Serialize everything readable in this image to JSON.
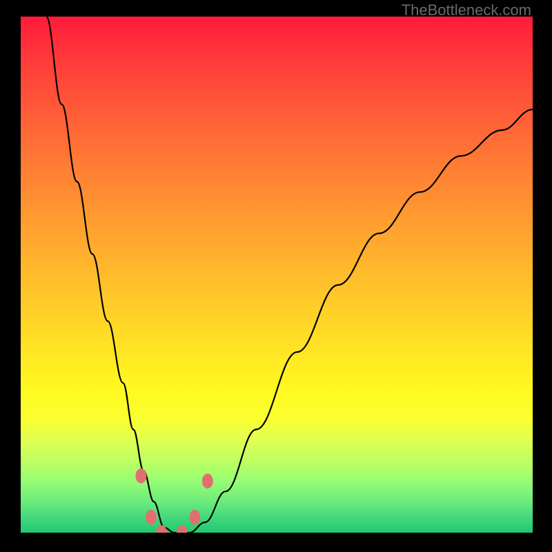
{
  "watermark": "TheBottleneck.com",
  "chart_data": {
    "type": "line",
    "title": "",
    "xlabel": "",
    "ylabel": "",
    "xlim": [
      0,
      100
    ],
    "ylim": [
      0,
      100
    ],
    "grid": false,
    "legend": false,
    "background_gradient": {
      "direction": "vertical",
      "stops": [
        {
          "pos": 0,
          "color": "#ff1a3a"
        },
        {
          "pos": 50,
          "color": "#ffc028"
        },
        {
          "pos": 78,
          "color": "#faff30"
        },
        {
          "pos": 100,
          "color": "#22c770"
        }
      ]
    },
    "series": [
      {
        "name": "bottleneck-curve",
        "color": "#000000",
        "x": [
          5,
          8,
          11,
          14,
          17,
          20,
          22,
          24,
          26,
          28,
          30,
          33,
          36,
          40,
          46,
          54,
          62,
          70,
          78,
          86,
          94,
          100
        ],
        "y": [
          100,
          83,
          68,
          54,
          41,
          29,
          20,
          12,
          6,
          1,
          0,
          0,
          2,
          8,
          20,
          35,
          48,
          58,
          66,
          73,
          78,
          82
        ]
      }
    ],
    "markers": [
      {
        "x": 23.5,
        "y": 11,
        "color": "#e07070",
        "r": 8
      },
      {
        "x": 25.5,
        "y": 3,
        "color": "#e07070",
        "r": 8
      },
      {
        "x": 27.5,
        "y": 0,
        "color": "#e07070",
        "r": 8
      },
      {
        "x": 31.5,
        "y": 0,
        "color": "#e07070",
        "r": 8
      },
      {
        "x": 34.0,
        "y": 3,
        "color": "#e07070",
        "r": 8
      },
      {
        "x": 36.5,
        "y": 10,
        "color": "#e07070",
        "r": 8
      }
    ]
  }
}
